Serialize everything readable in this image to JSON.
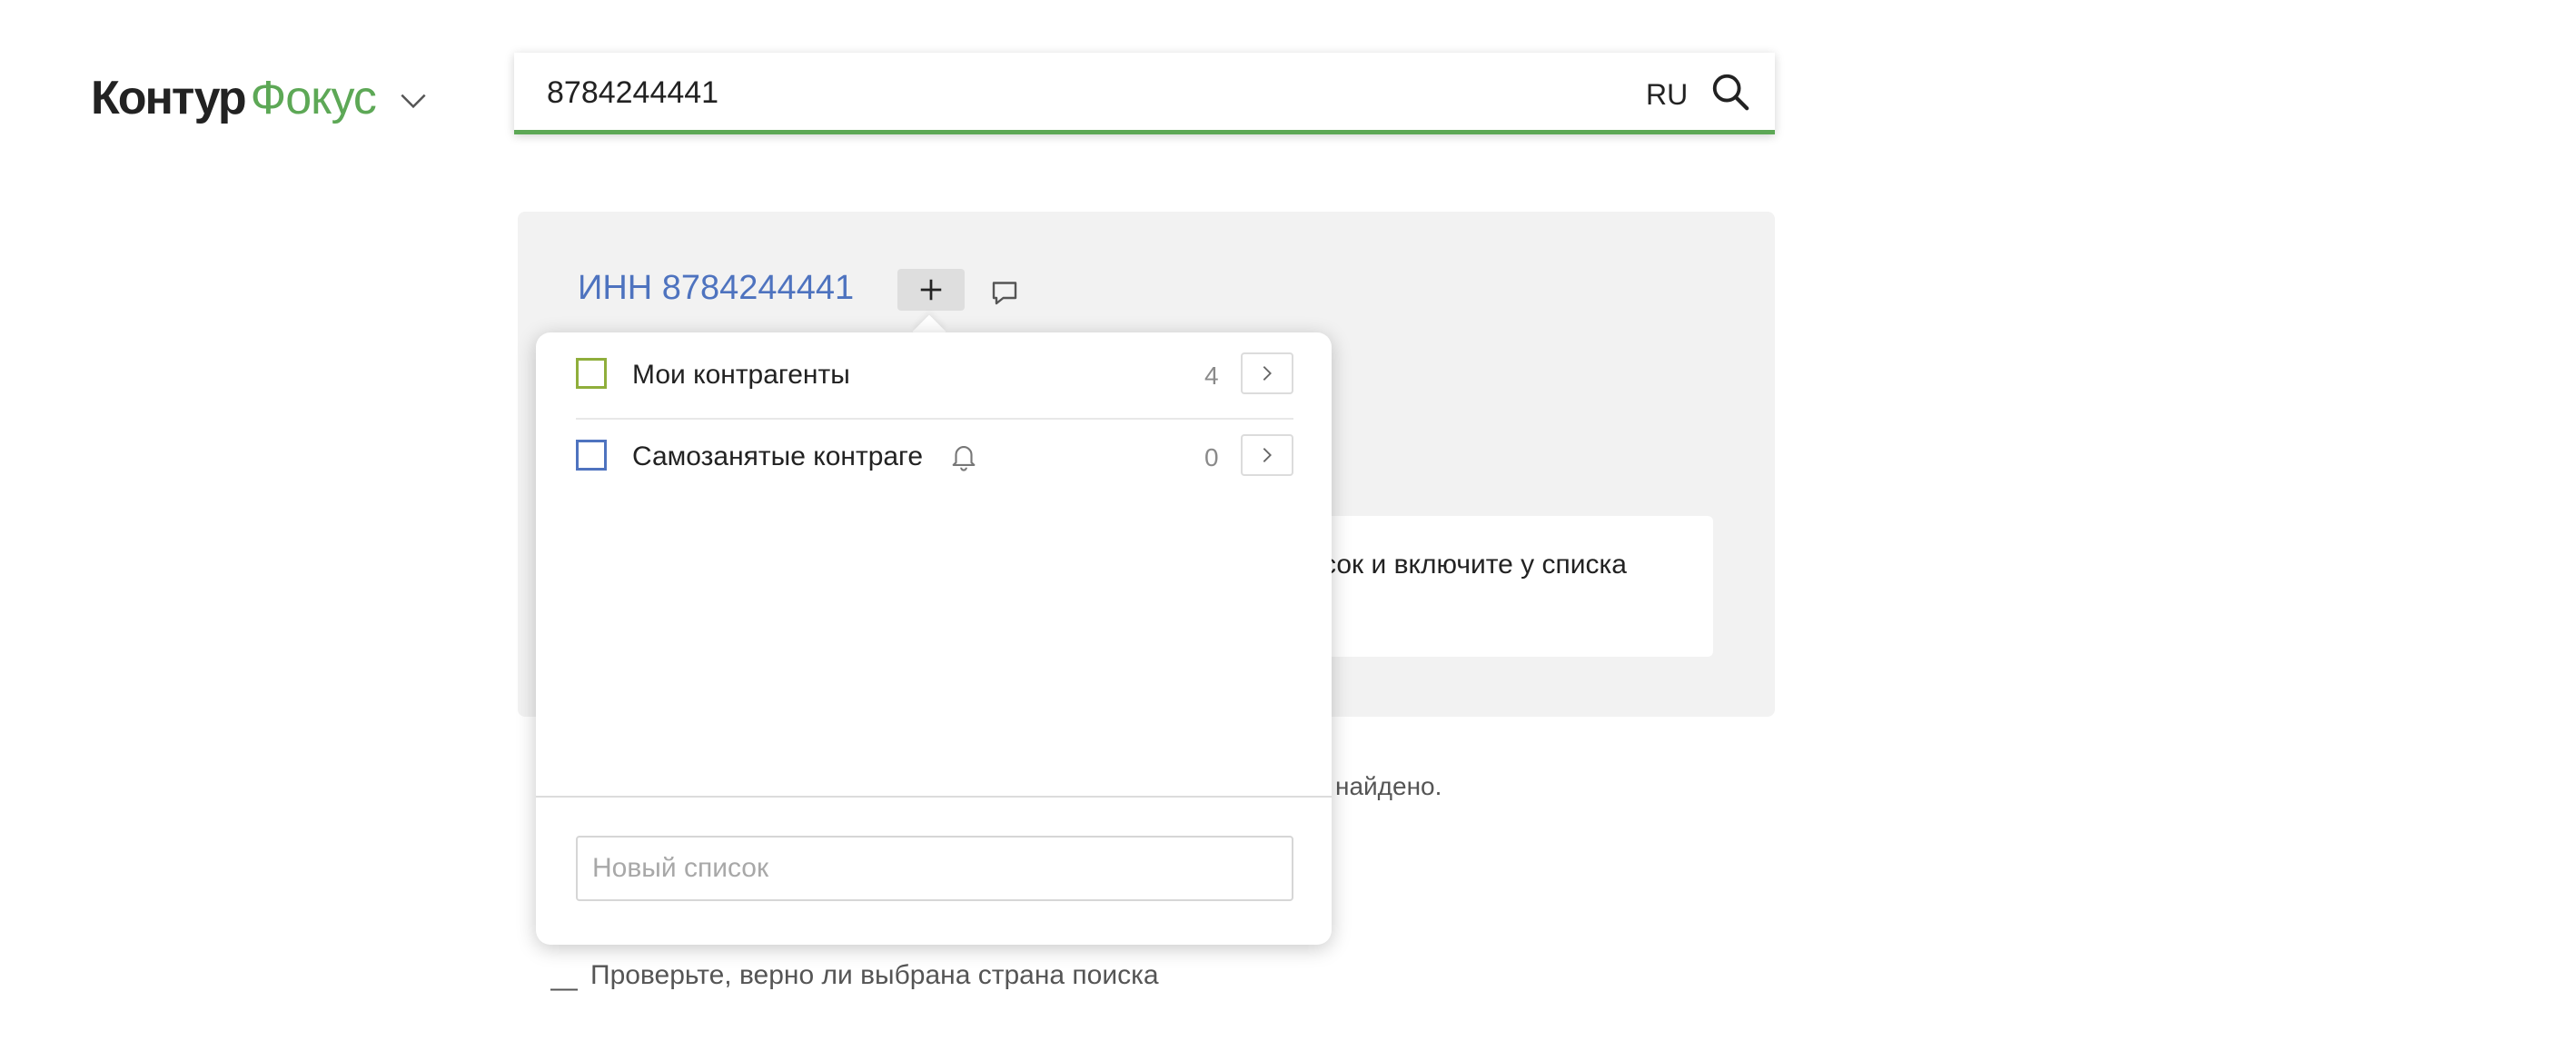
{
  "header": {
    "logo_primary": "Контур",
    "logo_secondary": "Фокус",
    "logo_menu_icon": "chevron-down-icon"
  },
  "search": {
    "value": "8784244441",
    "language": "RU",
    "icon": "search-icon"
  },
  "result": {
    "title": "ИНН 8784244441",
    "add_icon": "plus-icon",
    "comment_icon": "comment-icon",
    "hint_text": "сок и включите у списка",
    "not_found_text": "найдено.",
    "tip_dash": "—",
    "tip_text": "Проверьте, верно ли выбрана страна поиска"
  },
  "lists_popup": {
    "items": [
      {
        "label": "Мои контрагенты",
        "count": "4",
        "checkbox_color": "#8fae3b",
        "has_bell": false
      },
      {
        "label": "Самозанятые контраге",
        "count": "0",
        "checkbox_color": "#4e73bf",
        "has_bell": true
      }
    ],
    "new_list_placeholder": "Новый список"
  },
  "colors": {
    "brand_green": "#5da856",
    "link_blue": "#4e73bf",
    "card_bg": "#f2f2f2"
  }
}
